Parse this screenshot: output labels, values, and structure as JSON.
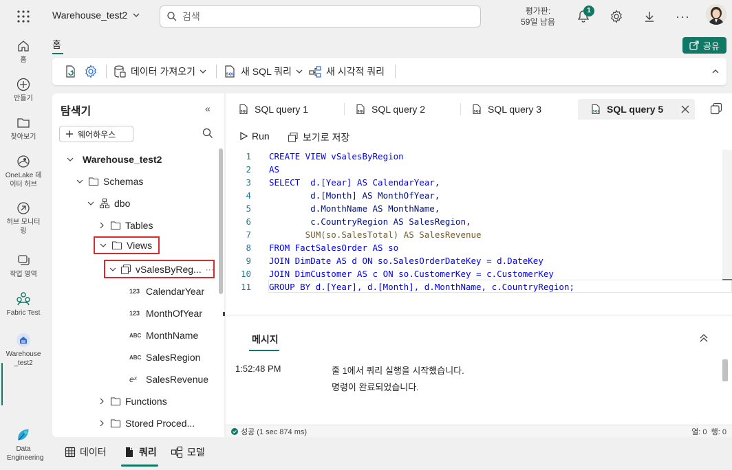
{
  "topbar": {
    "workspace": "Warehouse_test2",
    "search_placeholder": "검색",
    "trial_label": "평가판:",
    "trial_days": "59일 남음",
    "notification_count": "1",
    "accent": "#117865"
  },
  "rail": [
    {
      "label": "홈",
      "icon": "home-icon"
    },
    {
      "label": "만들기",
      "icon": "plus-circle-icon"
    },
    {
      "label": "찾아보기",
      "icon": "folder-icon"
    },
    {
      "label": "OneLake 데이터 허브",
      "icon": "onelake-icon"
    },
    {
      "label": "허브 모니터링",
      "icon": "monitor-icon"
    },
    {
      "label": "작업 영역",
      "icon": "workspaces-icon"
    },
    {
      "label": "Fabric Test",
      "icon": "fabric-test-icon"
    },
    {
      "label": "Warehouse_test2",
      "icon": "warehouse-icon"
    },
    {
      "label": "Data Engineering",
      "icon": "data-engineering-icon"
    }
  ],
  "home_tab": "홈",
  "share_label": "공유",
  "ribbon": {
    "get_data": "데이터 가져오기",
    "new_sql": "새 SQL 쿼리",
    "new_visual": "새 시각적 쿼리"
  },
  "explorer": {
    "title": "탐색기",
    "add_warehouse": "웨어하우스",
    "tree": {
      "warehouse": "Warehouse_test2",
      "schemas": "Schemas",
      "dbo": "dbo",
      "tables": "Tables",
      "views": "Views",
      "view_item": "vSalesByReg...",
      "columns": [
        {
          "type": "123",
          "name": "CalendarYear"
        },
        {
          "type": "123",
          "name": "MonthOfYear"
        },
        {
          "type": "ABC",
          "name": "MonthName"
        },
        {
          "type": "ABC",
          "name": "SalesRegion"
        },
        {
          "type": "eˣ",
          "name": "SalesRevenue"
        }
      ],
      "functions": "Functions",
      "stored_procs": "Stored Proced..."
    }
  },
  "query_tabs": [
    "SQL query 1",
    "SQL query 2",
    "SQL query 3",
    "SQL query 5"
  ],
  "toolbar": {
    "run": "Run",
    "save_view": "보기로 저장"
  },
  "code_lines": [
    "CREATE VIEW vSalesByRegion",
    "AS",
    "SELECT  d.[Year] AS CalendarYear,",
    "        d.[Month] AS MonthOfYear,",
    "        d.MonthName AS MonthName,",
    "        c.CountryRegion AS SalesRegion,",
    "       SUM(so.SalesTotal) AS SalesRevenue",
    "FROM FactSalesOrder AS so",
    "JOIN DimDate AS d ON so.SalesOrderDateKey = d.DateKey",
    "JOIN DimCustomer AS c ON so.CustomerKey = c.CustomerKey",
    "GROUP BY d.[Year], d.[Month], d.MonthName, c.CountryRegion;"
  ],
  "messages": {
    "tab": "메시지",
    "time": "1:52:48 PM",
    "line1": "줄 1에서 쿼리 실행을 시작했습니다.",
    "line2": "명령이 완료되었습니다."
  },
  "status": {
    "left": "성공 (1 sec 874 ms)",
    "right": "열: 0  행: 0"
  },
  "bottom_tabs": [
    "데이터",
    "쿼리",
    "모델"
  ]
}
